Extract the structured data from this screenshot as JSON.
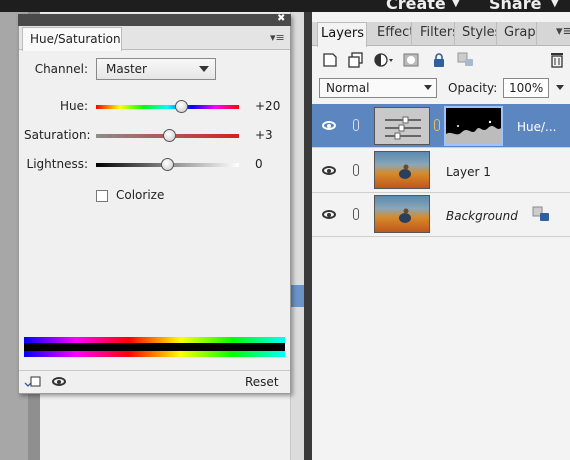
{
  "topbar": {
    "create_label": "Create",
    "share_label": "Share"
  },
  "layers_panel": {
    "tabs": [
      "Layers",
      "Effect",
      "Filters",
      "Styles",
      "Graph"
    ],
    "blend_mode": "Normal",
    "opacity_label": "Opacity:",
    "opacity_value": "100%",
    "layers": [
      {
        "name": "Hue/...",
        "selected": true,
        "italic": false
      },
      {
        "name": "Layer 1",
        "selected": false,
        "italic": false
      },
      {
        "name": "Background",
        "selected": false,
        "italic": true
      }
    ]
  },
  "hue_saturation": {
    "tab_label": "Hue/Saturation",
    "channel_label": "Channel:",
    "channel_value": "Master",
    "hue": {
      "label": "Hue:",
      "value": "+20"
    },
    "saturation": {
      "label": "Saturation:",
      "value": "+3"
    },
    "lightness": {
      "label": "Lightness:",
      "value": "0"
    },
    "colorize_label": "Colorize",
    "colorize_checked": false,
    "reset_label": "Reset"
  },
  "icons": [
    "close-icon",
    "panel-menu-icon",
    "eye-icon",
    "new-layer-icon",
    "duplicate-layer-icon",
    "adjustment-layer-icon",
    "mask-icon",
    "lock-icon",
    "link-icon",
    "delete-icon",
    "clip-to-layer-icon"
  ],
  "colors": {
    "selected_row": "#5b86bf",
    "panel_bg": "#f3f3f3",
    "topbar": "#1e1e1e"
  }
}
